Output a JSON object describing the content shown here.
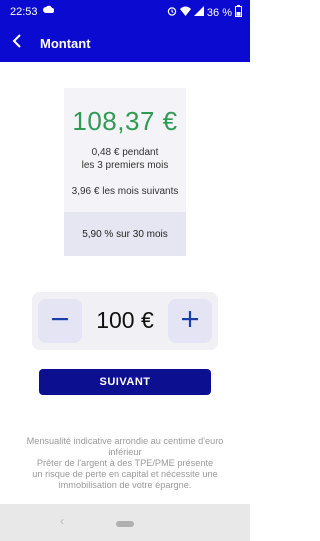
{
  "status_bar": {
    "time": "22:53",
    "battery_percent": "36 %",
    "icons": [
      "cloud-icon",
      "alarm-icon",
      "wifi-icon",
      "signal-icon",
      "battery-icon"
    ]
  },
  "header": {
    "title": "Montant",
    "back_icon": "chevron-left-icon"
  },
  "summary": {
    "amount": "108,37 €",
    "line1": "0,48 € pendant",
    "line2": "les 3 premiers mois",
    "line3": "3,96 € les mois suivants",
    "rate": "5,90 % sur 30 mois"
  },
  "stepper": {
    "value": "100 €",
    "minus_icon": "minus-icon",
    "plus_icon": "plus-icon"
  },
  "actions": {
    "next_label": "SUIVANT"
  },
  "disclaimer": {
    "line1": "Mensualité indicative arrondie au centime d'euro",
    "line2": "inférieur",
    "line3": "Prêter de l'argent à des TPE/PME présente",
    "line4": "un risque de perte en capital et nécessite une",
    "line5": "immobilisation de votre épargne."
  },
  "nav_bar": {
    "back_glyph": "‹"
  },
  "colors": {
    "primary": "#0a0ad0",
    "button": "#0c0f8f",
    "amount_green": "#2f9b54",
    "stepper_icon": "#1a3fa8"
  }
}
